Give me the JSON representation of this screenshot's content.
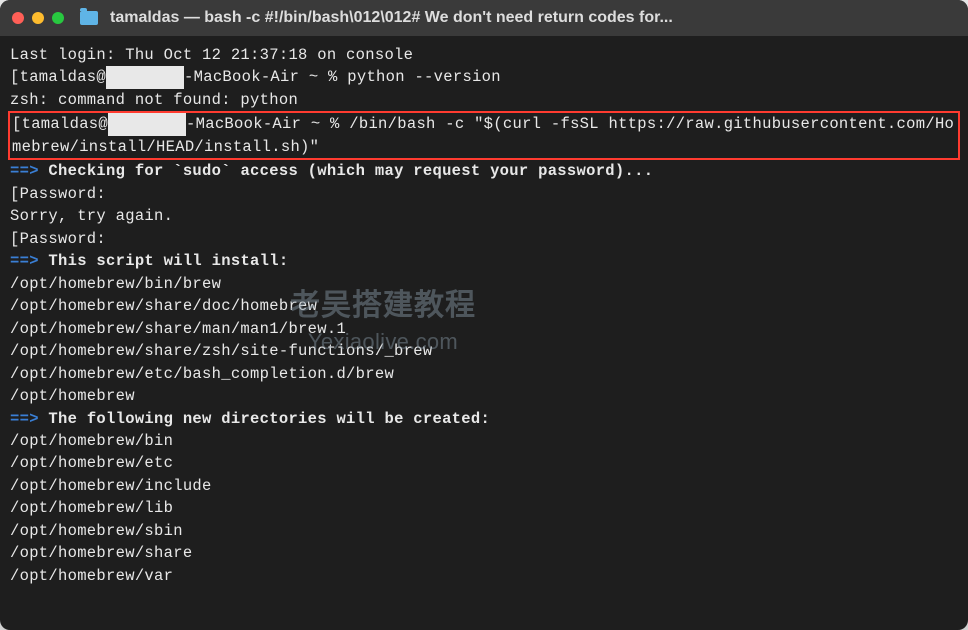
{
  "window": {
    "title": "tamaldas — bash -c #!/bin/bash\\012\\012# We don't need return codes for..."
  },
  "terminal": {
    "last_login": "Last login: Thu Oct 12 21:37:18 on console",
    "prompt1_user": "[tamaldas@",
    "prompt1_host": "-MacBook-Air ~ % ",
    "cmd1": "python --version",
    "zsh_error": "zsh: command not found: python",
    "prompt2_user": "[tamaldas@",
    "prompt2_host": "-MacBook-Air ~ % ",
    "cmd2": "/bin/bash -c \"$(curl -fsSL https://raw.githubusercontent.com/Homebrew/install/HEAD/install.sh)\"",
    "arrow": "==>",
    "checking_sudo": " Checking for `sudo` access (which may request your password)...",
    "password1": "[Password:",
    "sorry": "Sorry, try again.",
    "password2": "[Password:",
    "script_install": " This script will install:",
    "install_paths": [
      "/opt/homebrew/bin/brew",
      "/opt/homebrew/share/doc/homebrew",
      "/opt/homebrew/share/man/man1/brew.1",
      "/opt/homebrew/share/zsh/site-functions/_brew",
      "/opt/homebrew/etc/bash_completion.d/brew",
      "/opt/homebrew"
    ],
    "new_dirs": " The following new directories will be created:",
    "dir_paths": [
      "/opt/homebrew/bin",
      "/opt/homebrew/etc",
      "/opt/homebrew/include",
      "/opt/homebrew/lib",
      "/opt/homebrew/sbin",
      "/opt/homebrew/share",
      "/opt/homebrew/var"
    ]
  },
  "watermark": {
    "cn": "老吴搭建教程",
    "url": "Yexiaolive.com"
  }
}
